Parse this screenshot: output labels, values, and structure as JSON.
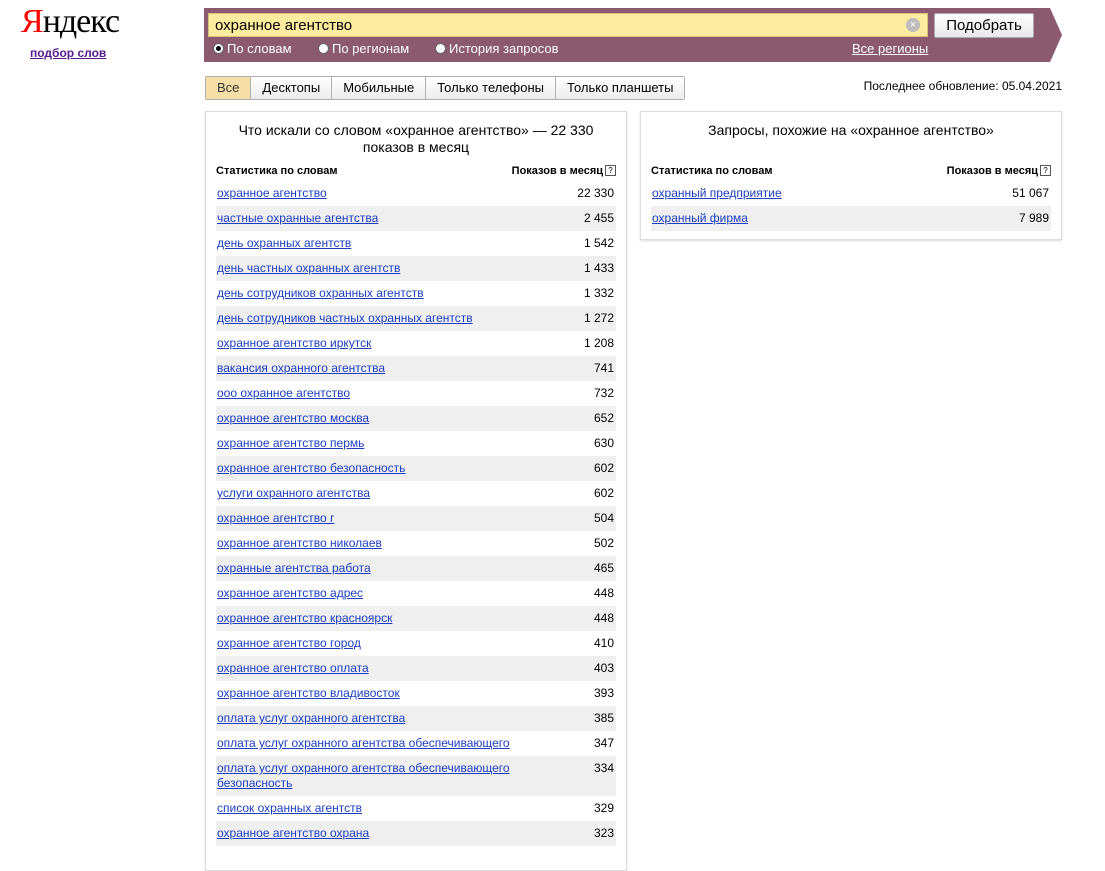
{
  "logo": {
    "first": "Я",
    "rest": "ндекс",
    "sub": "подбор слов"
  },
  "search": {
    "value": "охранное агентство",
    "submit": "Подобрать",
    "clear_icon": "×"
  },
  "radios": {
    "words": "По словам",
    "regions": "По регионам",
    "history": "История запросов",
    "all_regions": "Все регионы"
  },
  "tabs": [
    "Все",
    "Десктопы",
    "Мобильные",
    "Только телефоны",
    "Только планшеты"
  ],
  "last_update": "Последнее обновление: 05.04.2021",
  "left": {
    "title": "Что искали со словом «охранное агентство» — 22 330 показов в месяц",
    "col1": "Статистика по словам",
    "col2": "Показов в месяц",
    "help": "?",
    "rows": [
      {
        "q": "охранное агентство",
        "n": "22 330"
      },
      {
        "q": "частные охранные агентства",
        "n": "2 455"
      },
      {
        "q": "день охранных агентств",
        "n": "1 542"
      },
      {
        "q": "день частных охранных агентств",
        "n": "1 433"
      },
      {
        "q": "день сотрудников охранных агентств",
        "n": "1 332"
      },
      {
        "q": "день сотрудников частных охранных агентств",
        "n": "1 272"
      },
      {
        "q": "охранное агентство иркутск",
        "n": "1 208"
      },
      {
        "q": "вакансия охранного агентства",
        "n": "741"
      },
      {
        "q": "ооо охранное агентство",
        "n": "732"
      },
      {
        "q": "охранное агентство москва",
        "n": "652"
      },
      {
        "q": "охранное агентство пермь",
        "n": "630"
      },
      {
        "q": "охранное агентство безопасность",
        "n": "602"
      },
      {
        "q": "услуги охранного агентства",
        "n": "602"
      },
      {
        "q": "охранное агентство г",
        "n": "504"
      },
      {
        "q": "охранное агентство николаев",
        "n": "502"
      },
      {
        "q": "охранные агентства работа",
        "n": "465"
      },
      {
        "q": "охранное агентство адрес",
        "n": "448"
      },
      {
        "q": "охранное агентство красноярск",
        "n": "448"
      },
      {
        "q": "охранное агентство город",
        "n": "410"
      },
      {
        "q": "охранное агентство оплата",
        "n": "403"
      },
      {
        "q": "охранное агентство владивосток",
        "n": "393"
      },
      {
        "q": "оплата услуг охранного агентства",
        "n": "385"
      },
      {
        "q": "оплата услуг охранного агентства обеспечивающего",
        "n": "347"
      },
      {
        "q": "оплата услуг охранного агентства обеспечивающего безопасность",
        "n": "334"
      },
      {
        "q": "список охранных агентств",
        "n": "329"
      },
      {
        "q": "охранное агентство охрана",
        "n": "323"
      }
    ]
  },
  "right": {
    "title": "Запросы, похожие на «охранное агентство»",
    "col1": "Статистика по словам",
    "col2": "Показов в месяц",
    "help": "?",
    "rows": [
      {
        "q": "охранный предприятие",
        "n": "51 067"
      },
      {
        "q": "охранный фирма",
        "n": "7 989"
      }
    ]
  }
}
